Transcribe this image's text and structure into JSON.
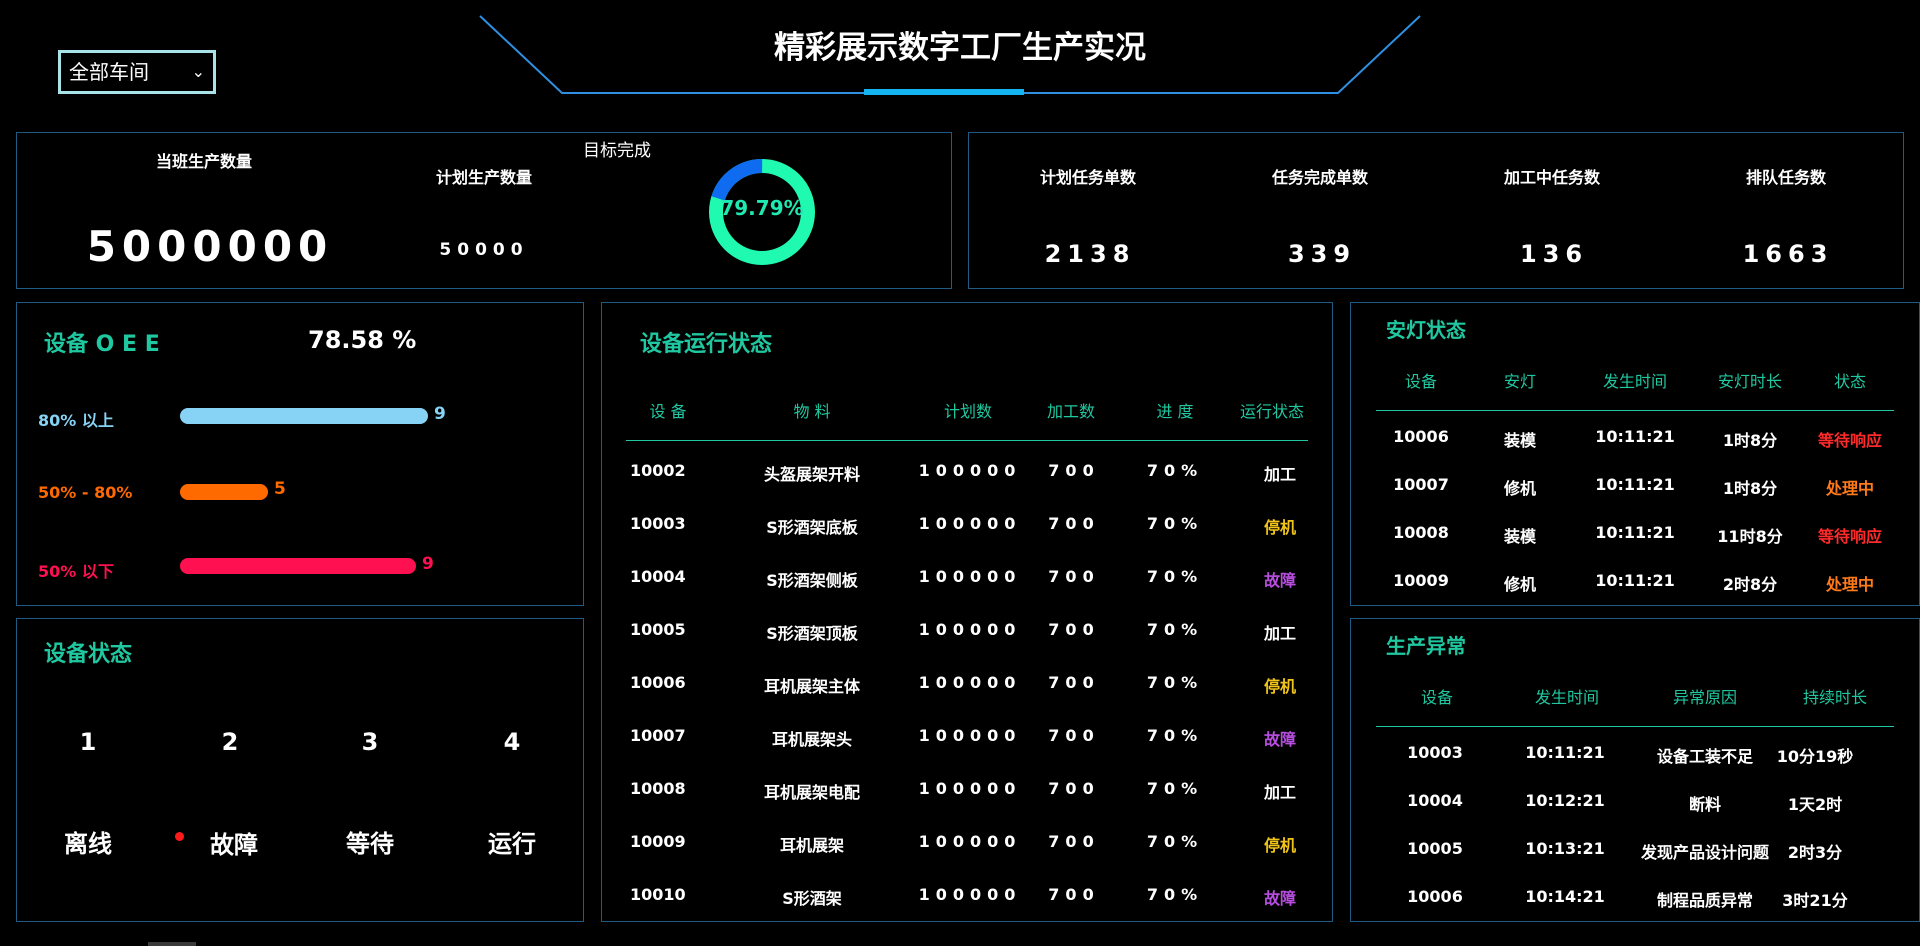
{
  "header": {
    "title": "精彩展示数字工厂生产实况",
    "workshop_select": "全部车间"
  },
  "production": {
    "current_label": "当班生产数量",
    "current_value": "5000000",
    "planned_label": "计划生产数量",
    "planned_value": "50000",
    "target_label": "目标完成",
    "target_percent_text": "79.79%",
    "target_percent": 79.79
  },
  "tasks": [
    {
      "label": "计划任务单数",
      "value": "2138"
    },
    {
      "label": "任务完成单数",
      "value": "339"
    },
    {
      "label": "加工中任务数",
      "value": "136"
    },
    {
      "label": "排队任务数",
      "value": "1663"
    }
  ],
  "oee": {
    "title": "设备 O E E",
    "value": "78.58 %",
    "rows": [
      {
        "label": "80% 以上",
        "count": 9,
        "color": "#87d3f5"
      },
      {
        "label": "50% - 80%",
        "count": 5,
        "color": "#ff6a00"
      },
      {
        "label": "50% 以下",
        "count": 9,
        "color": "#ff1050"
      }
    ]
  },
  "device_status": {
    "title": "设备状态",
    "items": [
      {
        "count": "1",
        "label": "离线"
      },
      {
        "count": "2",
        "label": "故障"
      },
      {
        "count": "3",
        "label": "等待"
      },
      {
        "count": "4",
        "label": "运行"
      }
    ]
  },
  "running": {
    "title": "设备运行状态",
    "headers": [
      "设 备",
      "物 料",
      "计划数",
      "加工数",
      "进 度",
      "运行状态"
    ],
    "rows": [
      {
        "device": "10002",
        "material": "头盔展架开料",
        "plan": "100000",
        "done": "700",
        "progress": "70%",
        "status": "加工",
        "color": "#ffffff"
      },
      {
        "device": "10003",
        "material": "S形酒架底板",
        "plan": "100000",
        "done": "700",
        "progress": "70%",
        "status": "停机",
        "color": "#f0c419"
      },
      {
        "device": "10004",
        "material": "S形酒架侧板",
        "plan": "100000",
        "done": "700",
        "progress": "70%",
        "status": "故障",
        "color": "#b84ee0"
      },
      {
        "device": "10005",
        "material": "S形酒架顶板",
        "plan": "100000",
        "done": "700",
        "progress": "70%",
        "status": "加工",
        "color": "#ffffff"
      },
      {
        "device": "10006",
        "material": "耳机展架主体",
        "plan": "100000",
        "done": "700",
        "progress": "70%",
        "status": "停机",
        "color": "#f0c419"
      },
      {
        "device": "10007",
        "material": "耳机展架头",
        "plan": "100000",
        "done": "700",
        "progress": "70%",
        "status": "故障",
        "color": "#b84ee0"
      },
      {
        "device": "10008",
        "material": "耳机展架电配",
        "plan": "100000",
        "done": "700",
        "progress": "70%",
        "status": "加工",
        "color": "#ffffff"
      },
      {
        "device": "10009",
        "material": "耳机展架",
        "plan": "100000",
        "done": "700",
        "progress": "70%",
        "status": "停机",
        "color": "#f0c419"
      },
      {
        "device": "10010",
        "material": "S形酒架",
        "plan": "100000",
        "done": "700",
        "progress": "70%",
        "status": "故障",
        "color": "#b84ee0"
      }
    ]
  },
  "andon": {
    "title": "安灯状态",
    "headers": [
      "设备",
      "安灯",
      "发生时间",
      "安灯时长",
      "状态"
    ],
    "rows": [
      {
        "device": "10006",
        "lamp": "装模",
        "time": "10:11:21",
        "duration": "1时8分",
        "status": "等待响应",
        "color": "#ff2a2a"
      },
      {
        "device": "10007",
        "lamp": "修机",
        "time": "10:11:21",
        "duration": "1时8分",
        "status": "处理中",
        "color": "#ff7a1a"
      },
      {
        "device": "10008",
        "lamp": "装模",
        "time": "10:11:21",
        "duration": "11时8分",
        "status": "等待响应",
        "color": "#ff2a2a"
      },
      {
        "device": "10009",
        "lamp": "修机",
        "time": "10:11:21",
        "duration": "2时8分",
        "status": "处理中",
        "color": "#ff7a1a"
      }
    ]
  },
  "exceptions": {
    "title": "生产异常",
    "headers": [
      "设备",
      "发生时间",
      "异常原因",
      "持续时长"
    ],
    "rows": [
      {
        "device": "10003",
        "time": "10:11:21",
        "reason": "设备工装不足",
        "duration": "10分19秒"
      },
      {
        "device": "10004",
        "time": "10:12:21",
        "reason": "断料",
        "duration": "1天2时"
      },
      {
        "device": "10005",
        "time": "10:13:21",
        "reason": "发现产品设计问题",
        "duration": "2时3分"
      },
      {
        "device": "10006",
        "time": "10:14:21",
        "reason": "制程品质异常",
        "duration": "3时21分"
      }
    ]
  }
}
